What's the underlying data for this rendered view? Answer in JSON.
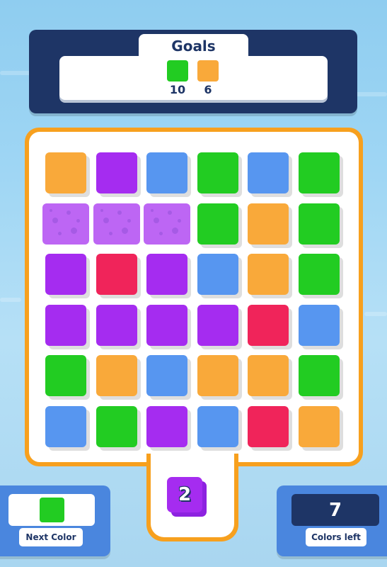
{
  "goals": {
    "title": "Goals",
    "items": [
      {
        "color": "#22cc22",
        "count": "10"
      },
      {
        "color": "#f9a93a",
        "count": "6"
      }
    ]
  },
  "board": {
    "colors": {
      "orange": "#f9a93a",
      "purple": "#a52cf0",
      "blue": "#5796f0",
      "green": "#22cc22",
      "red": "#f0245a"
    },
    "rows": [
      [
        "orange",
        "purple",
        "blue",
        "green",
        "blue",
        "green"
      ],
      [
        "purple",
        "purple",
        "purple",
        "green",
        "orange",
        "green"
      ],
      [
        "purple",
        "red",
        "purple",
        "blue",
        "orange",
        "green"
      ],
      [
        "purple",
        "purple",
        "purple",
        "purple",
        "red",
        "blue"
      ],
      [
        "green",
        "orange",
        "blue",
        "orange",
        "orange",
        "green"
      ],
      [
        "blue",
        "green",
        "purple",
        "blue",
        "red",
        "orange"
      ]
    ],
    "painting": [
      "1,0",
      "1,1",
      "1,2"
    ]
  },
  "next_stack": {
    "count": "2",
    "color": "#a52cf0"
  },
  "next_color": {
    "label": "Next Color",
    "color": "#22cc22"
  },
  "colors_left": {
    "label": "Colors left",
    "value": "7"
  }
}
